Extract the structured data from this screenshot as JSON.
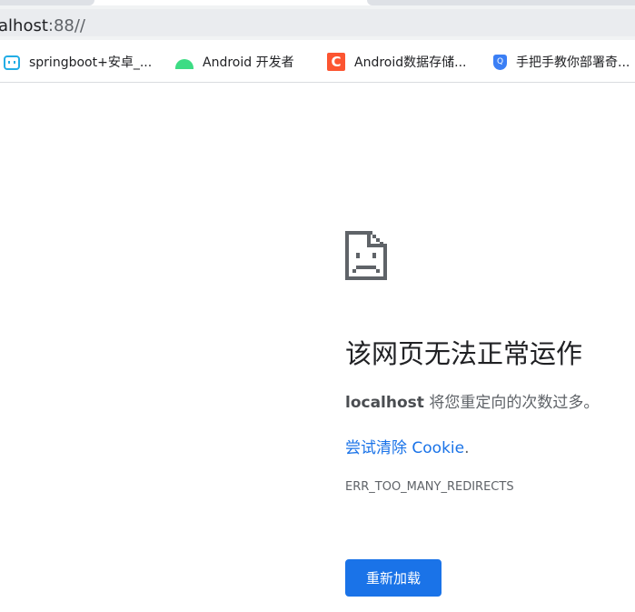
{
  "address_bar": {
    "host": "alhost",
    "rest": ":88//"
  },
  "bookmarks": [
    {
      "label": "springboot+安卓_...",
      "icon": "bilibili-icon"
    },
    {
      "label": "Android 开发者",
      "icon": "android-icon"
    },
    {
      "label": "Android数据存储...",
      "icon": "csdn-icon",
      "icon_text": "C"
    },
    {
      "label": "手把手教你部署奇...",
      "icon": "shield-icon",
      "icon_text": "Q"
    }
  ],
  "error": {
    "title": "该网页无法正常运作",
    "host": "localhost",
    "message": " 将您重定向的次数过多。",
    "suggestion_link": "尝试清除 Cookie",
    "suggestion_tail": ".",
    "code": "ERR_TOO_MANY_REDIRECTS",
    "reload_label": "重新加载"
  },
  "colors": {
    "accent": "#1a73e8",
    "text": "#202124",
    "secondary_text": "#5f6368"
  }
}
